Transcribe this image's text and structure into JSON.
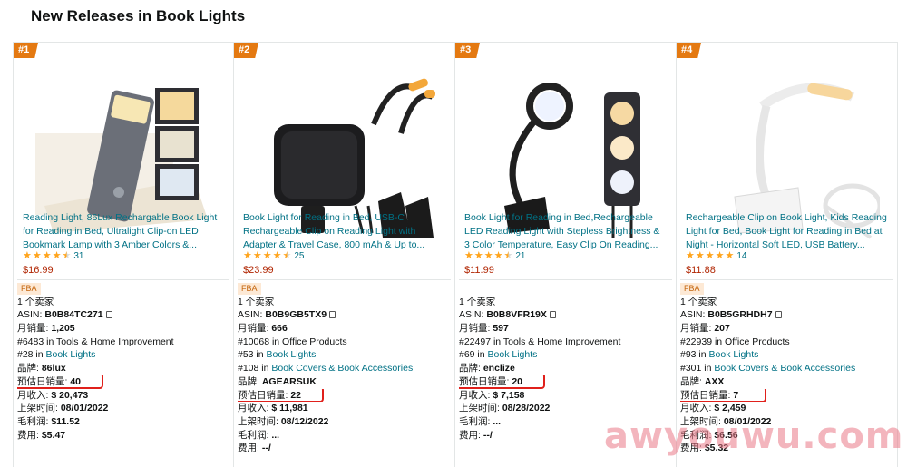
{
  "page": {
    "title": "New Releases in Book Lights"
  },
  "products": [
    {
      "rank": "#1",
      "title": "Reading Light, 86Lux Rechargable Book Light for Reading in Bed, Ultralight Clip-on LED Bookmark Lamp with 3 Amber Colors &...",
      "stars": 4.5,
      "review_count": "31",
      "price": "$16.99",
      "fba": "FBA",
      "sellers": "1 个卖家",
      "asin_label": "ASIN:",
      "asin": "B0B84TC271",
      "monthly_sales_label": "月销量:",
      "monthly_sales": "1,205",
      "rank_main": "#6483 in Tools & Home Improvement",
      "rank_sub_prefix": "#28 in",
      "rank_sub_category": "Book Lights",
      "rank_sub2_prefix": "",
      "rank_sub2_category": "",
      "brand_label": "品牌:",
      "brand": "86lux",
      "daily_sales_label": "预估日销量:",
      "daily_sales": "40",
      "revenue_label": "月收入:",
      "revenue": "$ 20,473",
      "date_label": "上架时间:",
      "date": "08/01/2022",
      "margin_label": "毛利润:",
      "margin": "$11.52",
      "fee_label": "费用:",
      "fee": "$5.47"
    },
    {
      "rank": "#2",
      "title": "Book Light for Reading in Bed, USB-C Rechargeable Clip on Reading Light with Adapter & Travel Case, 800 mAh & Up to...",
      "stars": 4.5,
      "review_count": "25",
      "price": "$23.99",
      "fba": "FBA",
      "sellers": "1 个卖家",
      "asin_label": "ASIN:",
      "asin": "B0B9GB5TX9",
      "monthly_sales_label": "月销量:",
      "monthly_sales": "666",
      "rank_main": "#10068 in Office Products",
      "rank_sub_prefix": "#53 in",
      "rank_sub_category": "Book Lights",
      "rank_sub2_prefix": "#108 in",
      "rank_sub2_category": "Book Covers & Book Accessories",
      "brand_label": "品牌:",
      "brand": "AGEARSUK",
      "daily_sales_label": "预估日销量:",
      "daily_sales": "22",
      "revenue_label": "月收入:",
      "revenue": "$ 11,981",
      "date_label": "上架时间:",
      "date": "08/12/2022",
      "margin_label": "毛利润:",
      "margin": "...",
      "fee_label": "费用:",
      "fee": "--/"
    },
    {
      "rank": "#3",
      "title": "Book Light for Reading in Bed,Rechargeable LED Reading Light with Stepless Brightness & 3 Color Temperature, Easy Clip On Reading...",
      "stars": 4.5,
      "review_count": "21",
      "price": "$11.99",
      "fba": "",
      "sellers": "1 个卖家",
      "asin_label": "ASIN:",
      "asin": "B0B8VFR19X",
      "monthly_sales_label": "月销量:",
      "monthly_sales": "597",
      "rank_main": "#22497 in Tools & Home Improvement",
      "rank_sub_prefix": "#69 in",
      "rank_sub_category": "Book Lights",
      "rank_sub2_prefix": "",
      "rank_sub2_category": "",
      "brand_label": "品牌:",
      "brand": "enclize",
      "daily_sales_label": "预估日销量:",
      "daily_sales": "20",
      "revenue_label": "月收入:",
      "revenue": "$ 7,158",
      "date_label": "上架时间:",
      "date": "08/28/2022",
      "margin_label": "毛利润:",
      "margin": "...",
      "fee_label": "费用:",
      "fee": "--/"
    },
    {
      "rank": "#4",
      "title": "Rechargeable Clip on Book Light, Kids Reading Light for Bed, Book Light for Reading in Bed at Night - Horizontal Soft LED, USB Battery...",
      "stars": 5,
      "review_count": "14",
      "price": "$11.88",
      "fba": "FBA",
      "sellers": "1 个卖家",
      "asin_label": "ASIN:",
      "asin": "B0B5GRHDH7",
      "monthly_sales_label": "月销量:",
      "monthly_sales": "207",
      "rank_main": "#22939 in Office Products",
      "rank_sub_prefix": "#93 in",
      "rank_sub_category": "Book Lights",
      "rank_sub2_prefix": "#301 in",
      "rank_sub2_category": "Book Covers & Book Accessories",
      "brand_label": "品牌:",
      "brand": "AXX",
      "daily_sales_label": "预估日销量:",
      "daily_sales": "7",
      "revenue_label": "月收入:",
      "revenue": "$ 2,459",
      "date_label": "上架时间:",
      "date": "08/01/2022",
      "margin_label": "毛利润:",
      "margin": "$6.56",
      "fee_label": "费用:",
      "fee": "$5.32"
    }
  ],
  "watermark": "awyouwu.com",
  "colors": {
    "accent": "#e47911",
    "link": "#007185",
    "price": "#b12704",
    "highlight": "#e0201b",
    "star": "#ffa41c"
  }
}
